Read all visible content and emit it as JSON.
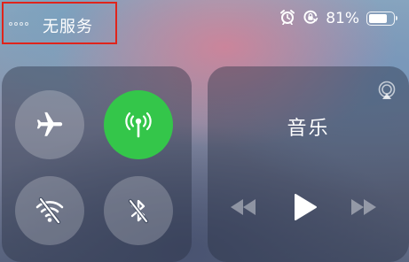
{
  "status_bar": {
    "carrier_text": "无服务",
    "battery_percent_text": "81%",
    "battery_level": 0.81,
    "icons": [
      "signal-dots-icon",
      "alarm-icon",
      "orientation-lock-icon",
      "battery-icon"
    ]
  },
  "connectivity": {
    "airplane_mode": {
      "state": "off",
      "icon": "airplane-icon"
    },
    "cellular_data": {
      "state": "on",
      "icon": "cellular-antenna-icon",
      "color": "#34c64a"
    },
    "wifi": {
      "state": "off",
      "icon": "wifi-off-icon"
    },
    "bluetooth": {
      "state": "off",
      "icon": "bluetooth-off-icon"
    }
  },
  "music": {
    "title": "音乐",
    "controls": [
      "previous-icon",
      "play-icon",
      "next-icon",
      "airplay-icon"
    ]
  },
  "colors": {
    "highlight_box": "#e0241b",
    "active_toggle": "#34c64a"
  }
}
